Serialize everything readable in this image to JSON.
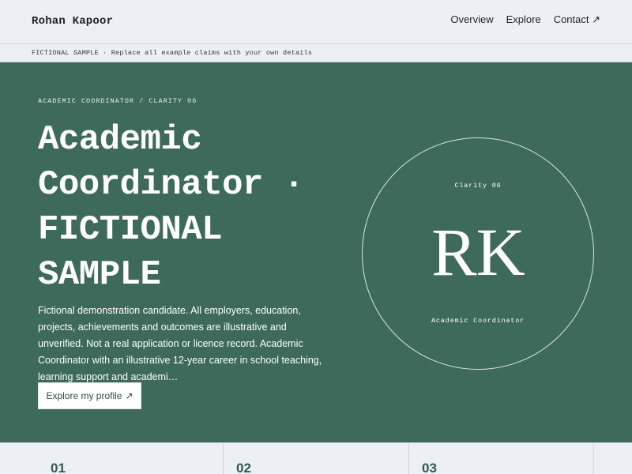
{
  "header": {
    "brand": "Rohan Kapoor",
    "nav": {
      "overview": "Overview",
      "explore": "Explore",
      "contact": "Contact ↗"
    }
  },
  "notice": {
    "text": "FICTIONAL SAMPLE · Replace all example claims with your own details"
  },
  "hero": {
    "eyebrow": "ACADEMIC COORDINATOR / CLARITY 06",
    "title": "Academic Coordinator · FICTIONAL SAMPLE",
    "description": "Fictional demonstration candidate. All employers, education, projects, achievements and outcomes are illustrative and unverified. Not a real application or licence record. Academic Coordinator with an illustrative 12-year career in school teaching, learning support and academi…",
    "cta_label": "Explore my profile",
    "cta_icon": "↗"
  },
  "badge": {
    "top_label": "Clarity 06",
    "initials": "RK",
    "bottom_label": "Academic Coordinator"
  },
  "stats": {
    "items": [
      {
        "number": "01"
      },
      {
        "number": "02"
      },
      {
        "number": "03"
      }
    ]
  },
  "colors": {
    "hero_bg": "#3d6a5a",
    "page_bg": "#eceff6",
    "accent": "#2f5a4c"
  }
}
